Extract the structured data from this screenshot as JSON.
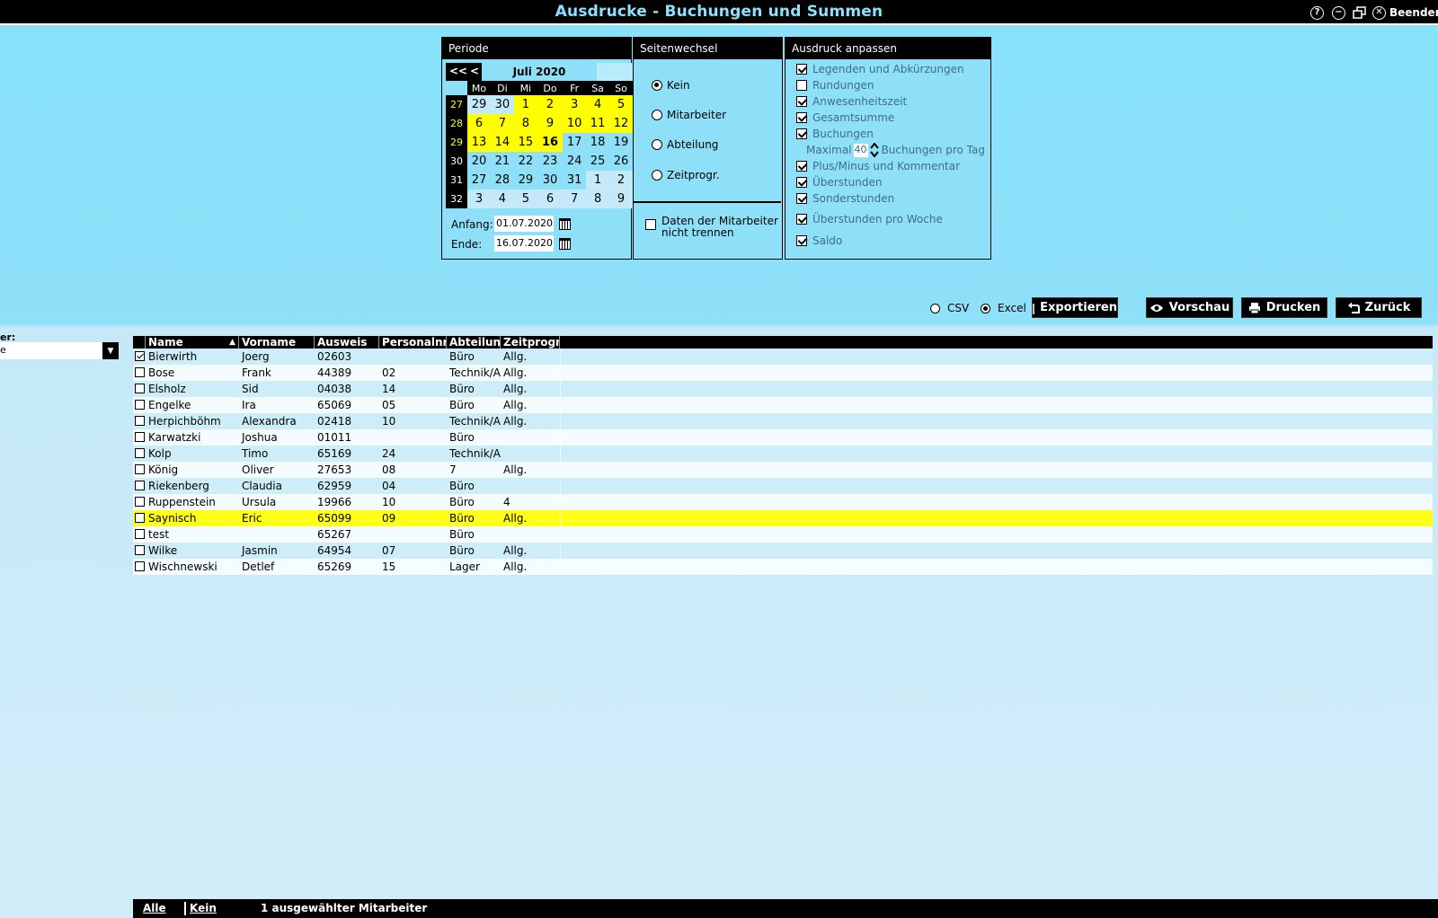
{
  "window": {
    "title": "Ausdrucke - Buchungen und Summen",
    "close_label": "Beenden"
  },
  "periode": {
    "header": "Periode",
    "nav_prev_year": "<<",
    "nav_prev_month": "<",
    "nav_next_month": ">",
    "nav_next_year": ">>",
    "month_label": "Juli 2020",
    "weekdays": [
      "Mo",
      "Di",
      "Mi",
      "Do",
      "Fr",
      "Sa",
      "So"
    ],
    "weeks": [
      {
        "wk": "27",
        "days": [
          "29",
          "30",
          "1",
          "2",
          "3",
          "4",
          "5"
        ]
      },
      {
        "wk": "28",
        "days": [
          "6",
          "7",
          "8",
          "9",
          "10",
          "11",
          "12"
        ]
      },
      {
        "wk": "29",
        "days": [
          "13",
          "14",
          "15",
          "16",
          "17",
          "18",
          "19"
        ]
      },
      {
        "wk": "30",
        "days": [
          "20",
          "21",
          "22",
          "23",
          "24",
          "25",
          "26"
        ]
      },
      {
        "wk": "31",
        "days": [
          "27",
          "28",
          "29",
          "30",
          "31",
          "1",
          "2"
        ]
      },
      {
        "wk": "32",
        "days": [
          "3",
          "4",
          "5",
          "6",
          "7",
          "8",
          "9"
        ]
      }
    ],
    "start_label": "Anfang:",
    "start_value": "01.07.2020",
    "end_label": "Ende:",
    "end_value": "16.07.2020"
  },
  "seitenwechsel": {
    "header": "Seitenwechsel",
    "options": [
      "Kein",
      "Mitarbeiter",
      "Abteilung",
      "Zeitprogr."
    ],
    "selected": "Kein",
    "no_split_label_1": "Daten der Mitarbeiter",
    "no_split_label_2": "nicht trennen"
  },
  "ausdruck": {
    "header": "Ausdruck anpassen",
    "options": [
      {
        "label": "Legenden und Abkürzungen",
        "checked": true
      },
      {
        "label": "Rundungen",
        "checked": false
      },
      {
        "label": "Anwesenheitszeit",
        "checked": true
      },
      {
        "label": "Gesamtsumme",
        "checked": true
      },
      {
        "label": "Buchungen",
        "checked": true
      },
      {
        "label": "Plus/Minus und Kommentar",
        "checked": true
      },
      {
        "label": "Überstunden",
        "checked": true
      },
      {
        "label": "Sonderstunden",
        "checked": true
      },
      {
        "label": "Überstunden pro Woche",
        "checked": true
      },
      {
        "label": "Saldo",
        "checked": true
      }
    ],
    "max_label": "Maximal",
    "max_value": "40",
    "max_suffix": "Buchungen pro Tag"
  },
  "export": {
    "csv_label": "CSV",
    "excel_label": "Excel",
    "selected": "Excel",
    "export_button": "Exportieren",
    "preview_button": "Vorschau",
    "print_button": "Drucken",
    "back_button": "Zurück"
  },
  "filter": {
    "label": "er:",
    "value": "e"
  },
  "table": {
    "columns": [
      "Name",
      "Vorname",
      "Ausweis",
      "Personalnr.",
      "Abteilung",
      "Zeitprogr."
    ],
    "rows": [
      {
        "checked": true,
        "name": "Bierwirth",
        "vorname": "Joerg",
        "ausweis": "02603",
        "personalnr": "",
        "abteilung": "Büro",
        "zeitprogr": "Allg."
      },
      {
        "checked": false,
        "name": "Bose",
        "vorname": "Frank",
        "ausweis": "44389",
        "personalnr": "02",
        "abteilung": "Technik/Au",
        "zeitprogr": "Allg."
      },
      {
        "checked": false,
        "name": "Elsholz",
        "vorname": "Sid",
        "ausweis": "04038",
        "personalnr": "14",
        "abteilung": "Büro",
        "zeitprogr": "Allg."
      },
      {
        "checked": false,
        "name": "Engelke",
        "vorname": "Ira",
        "ausweis": "65069",
        "personalnr": "05",
        "abteilung": "Büro",
        "zeitprogr": "Allg."
      },
      {
        "checked": false,
        "name": "Herpichböhm",
        "vorname": "Alexandra",
        "ausweis": "02418",
        "personalnr": "10",
        "abteilung": "Technik/Au",
        "zeitprogr": "Allg."
      },
      {
        "checked": false,
        "name": "Karwatzki",
        "vorname": "Joshua",
        "ausweis": "01011",
        "personalnr": "",
        "abteilung": "Büro",
        "zeitprogr": ""
      },
      {
        "checked": false,
        "name": "Kolp",
        "vorname": "Timo",
        "ausweis": "65169",
        "personalnr": "24",
        "abteilung": "Technik/Au",
        "zeitprogr": ""
      },
      {
        "checked": false,
        "name": "König",
        "vorname": "Oliver",
        "ausweis": "27653",
        "personalnr": "08",
        "abteilung": "7",
        "zeitprogr": "Allg."
      },
      {
        "checked": false,
        "name": "Riekenberg",
        "vorname": "Claudia",
        "ausweis": "62959",
        "personalnr": "04",
        "abteilung": "Büro",
        "zeitprogr": ""
      },
      {
        "checked": false,
        "name": "Ruppenstein",
        "vorname": "Ursula",
        "ausweis": "19966",
        "personalnr": "10",
        "abteilung": "Büro",
        "zeitprogr": "4"
      },
      {
        "checked": false,
        "name": "Saynisch",
        "vorname": "Eric",
        "ausweis": "65099",
        "personalnr": "09",
        "abteilung": "Büro",
        "zeitprogr": "Allg."
      },
      {
        "checked": false,
        "name": "test",
        "vorname": "",
        "ausweis": "65267",
        "personalnr": "",
        "abteilung": "Büro",
        "zeitprogr": ""
      },
      {
        "checked": false,
        "name": "Wilke",
        "vorname": "Jasmin",
        "ausweis": "64954",
        "personalnr": "07",
        "abteilung": "Büro",
        "zeitprogr": "Allg."
      },
      {
        "checked": false,
        "name": "Wischnewski",
        "vorname": "Detlef",
        "ausweis": "65269",
        "personalnr": "15",
        "abteilung": "Lager",
        "zeitprogr": "Allg."
      }
    ]
  },
  "status": {
    "all_label": "Alle",
    "none_label": "Kein",
    "selection_text": "1 ausgewählter Mitarbeiter"
  },
  "colors": {
    "accent": "#8ee0f8",
    "highlight": "#ffff1a",
    "title_text": "#8ee0ff"
  }
}
